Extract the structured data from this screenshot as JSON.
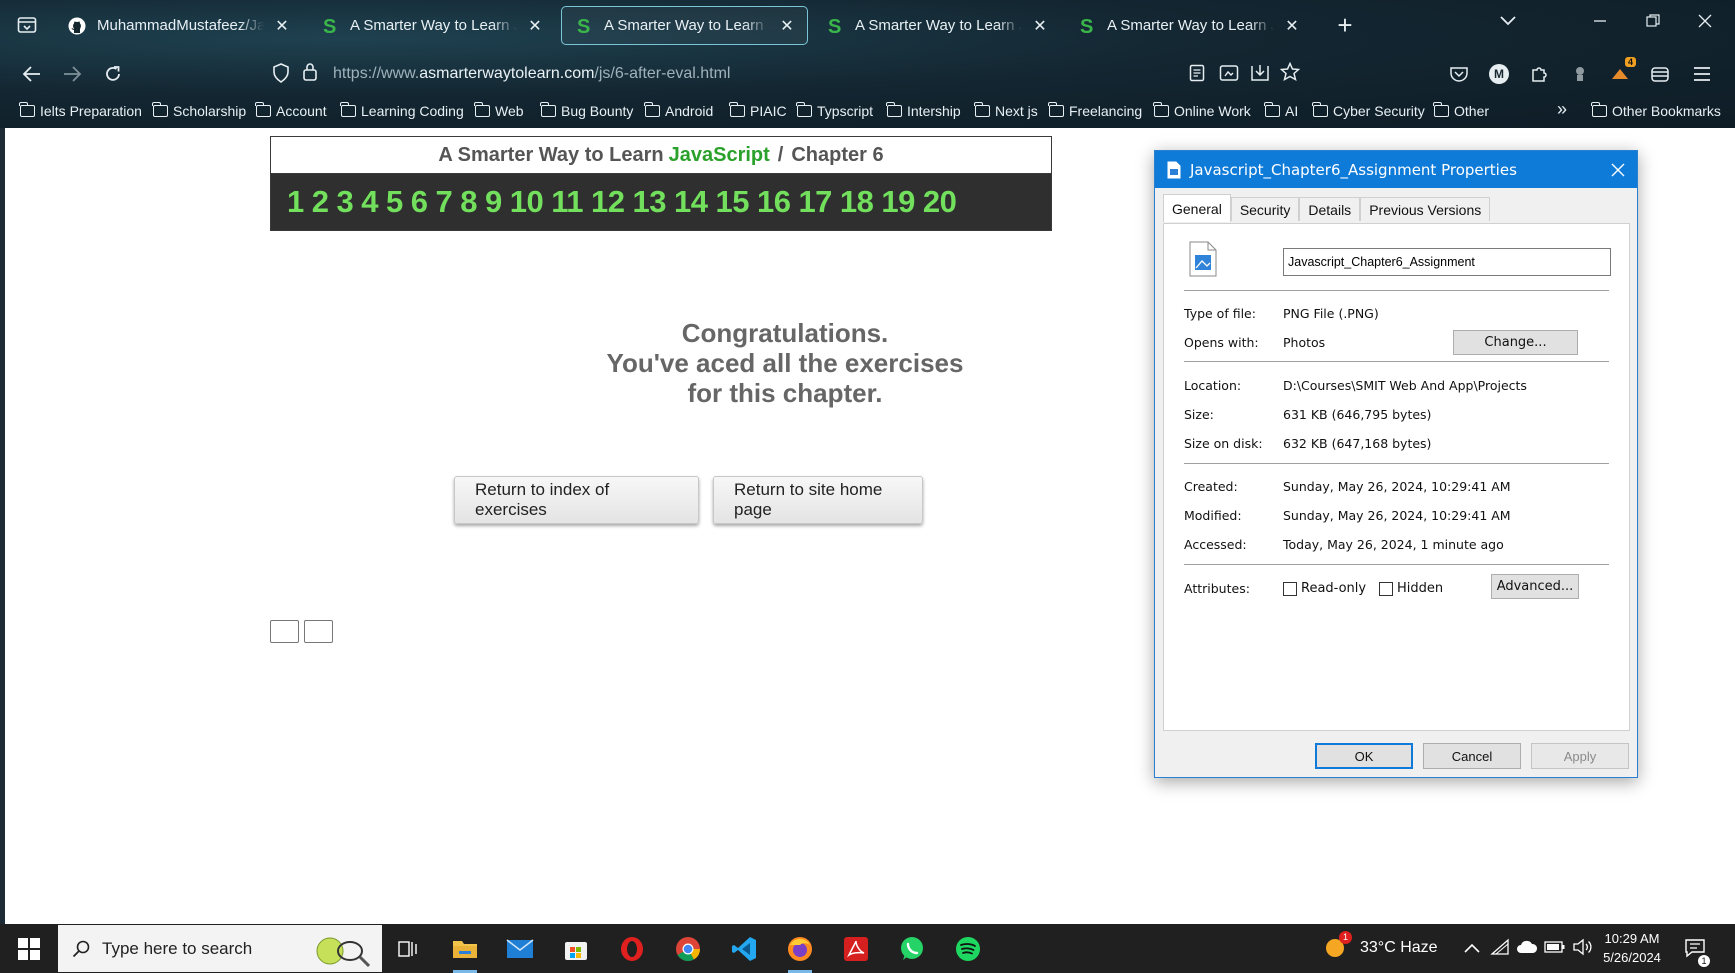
{
  "browser": {
    "tabs": [
      {
        "title": "MuhammadMustafeez/Javascript",
        "favicon": "github-icon",
        "active": false
      },
      {
        "title": "A Smarter Way to Learn JavaScript",
        "favicon": "smarter-way-s-icon",
        "active": false
      },
      {
        "title": "A Smarter Way to Learn JavaScript",
        "favicon": "smarter-way-s-icon",
        "active": true
      },
      {
        "title": "A Smarter Way to Learn JavaScript",
        "favicon": "smarter-way-s-icon",
        "active": false
      },
      {
        "title": "A Smarter Way to Learn JavaScript",
        "favicon": "smarter-way-s-icon",
        "active": false
      }
    ],
    "new_tab": "+",
    "url_prefix": "https://www.",
    "url_domain": "asmarterwaytolearn.com",
    "url_path": "/js/6-after-eval.html",
    "extension_badge": "4",
    "account_initial": "M",
    "bookmarks": [
      "Ielts Preparation",
      "Scholarship",
      "Account",
      "Learning Coding",
      "Web",
      "Bug Bounty",
      "Android",
      "PIAIC",
      "Typscript",
      "Intership",
      "Next js",
      "Freelancing",
      "Online Work",
      "AI",
      "Cyber Security",
      "Other"
    ],
    "other_bookmarks": "Other Bookmarks",
    "overflow": "»"
  },
  "page": {
    "header_prefix": "A Smarter Way to Learn",
    "header_js": "JavaScript",
    "header_sep": "/",
    "header_chapter": "Chapter 6",
    "numbers": [
      "1",
      "2",
      "3",
      "4",
      "5",
      "6",
      "7",
      "8",
      "9",
      "10",
      "11",
      "12",
      "13",
      "14",
      "15",
      "16",
      "17",
      "18",
      "19",
      "20"
    ],
    "congrats_line1": "Congratulations.",
    "congrats_line2": "You've aced all the exercises",
    "congrats_line3": "for this chapter.",
    "btn_index": "Return to index of exercises",
    "btn_home": "Return to site home page"
  },
  "dialog": {
    "title": "Javascript_Chapter6_Assignment Properties",
    "tabs": [
      "General",
      "Security",
      "Details",
      "Previous Versions"
    ],
    "file_name": "Javascript_Chapter6_Assignment",
    "type_label": "Type of file:",
    "type_value": "PNG File (.PNG)",
    "opens_label": "Opens with:",
    "opens_value": "Photos",
    "change_btn": "Change...",
    "location_label": "Location:",
    "location_value": "D:\\Courses\\SMIT Web And App\\Projects",
    "size_label": "Size:",
    "size_value": "631 KB (646,795 bytes)",
    "size_disk_label": "Size on disk:",
    "size_disk_value": "632 KB (647,168 bytes)",
    "created_label": "Created:",
    "created_value": "Sunday, May 26, 2024, 10:29:41 AM",
    "modified_label": "Modified:",
    "modified_value": "Sunday, May 26, 2024, 10:29:41 AM",
    "accessed_label": "Accessed:",
    "accessed_value": "Today, May 26, 2024, 1 minute ago",
    "attributes_label": "Attributes:",
    "readonly_label": "Read-only",
    "hidden_label": "Hidden",
    "advanced_btn": "Advanced...",
    "ok_btn": "OK",
    "cancel_btn": "Cancel",
    "apply_btn": "Apply"
  },
  "taskbar": {
    "search_placeholder": "Type here to search",
    "weather": "33°C  Haze",
    "weather_badge": "1",
    "time": "10:29 AM",
    "date": "5/26/2024",
    "notification_count": "1"
  },
  "colors": {
    "accent_green": "#72e05c",
    "js_green": "#2aa12a",
    "dialog_blue": "#0f7bd8"
  }
}
